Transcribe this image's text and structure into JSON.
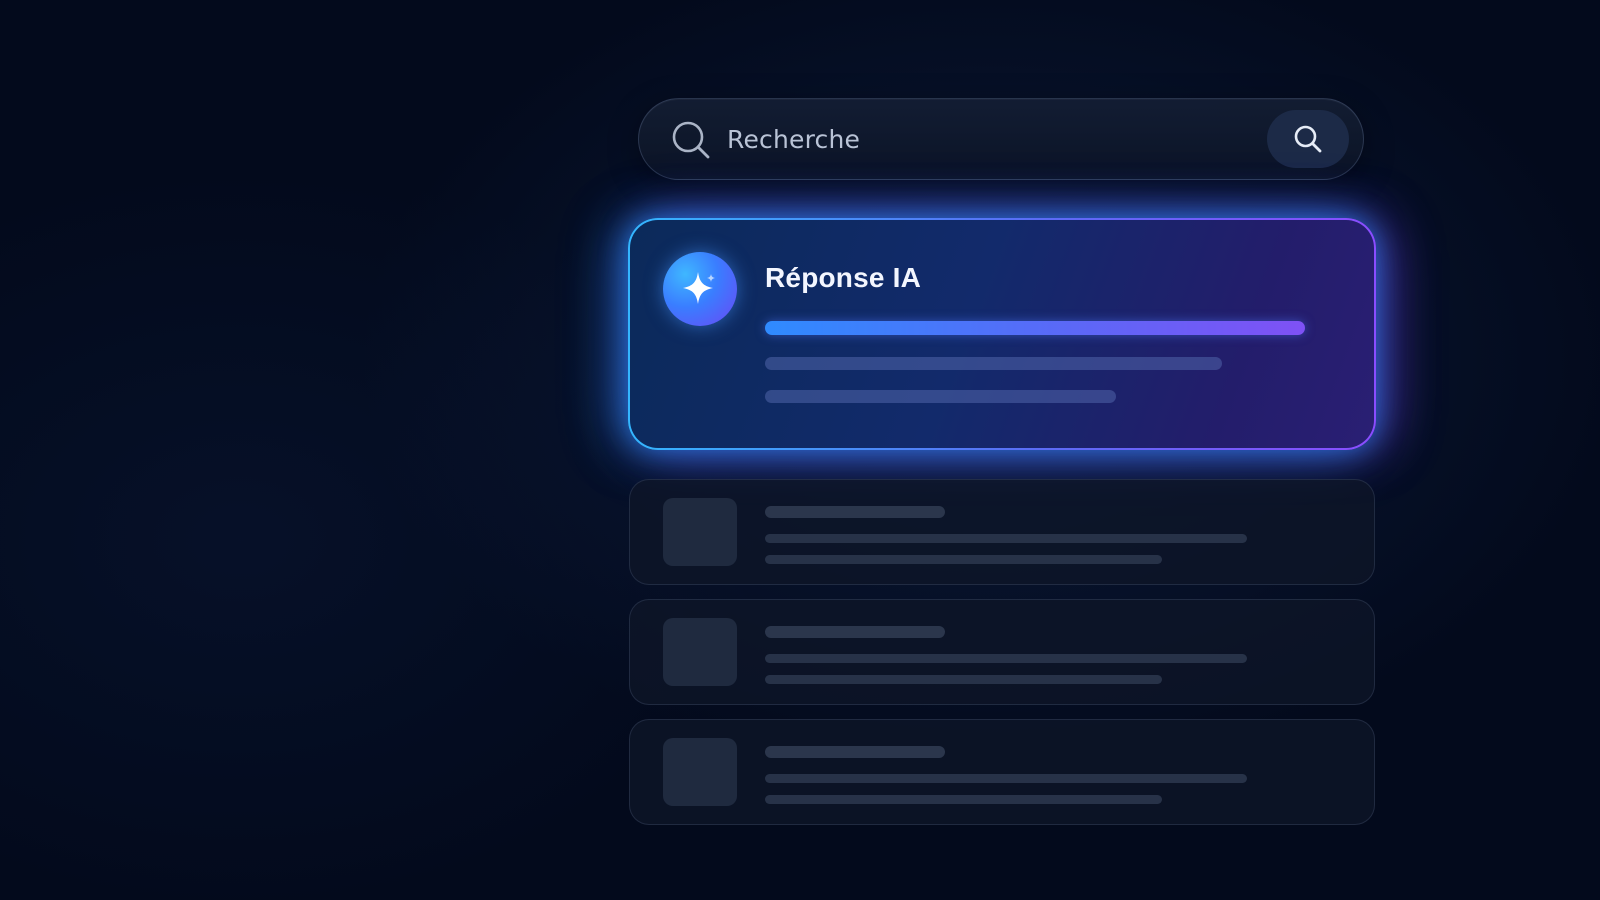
{
  "search": {
    "placeholder": "Recherche",
    "leading_icon": "search-icon",
    "button_icon": "search-icon"
  },
  "ai_card": {
    "title": "Réponse IA",
    "icon": "sparkle-icon",
    "colors": {
      "accent_start": "#34b6ff",
      "accent_end": "#8a4dff"
    }
  },
  "results": [
    {
      "type": "skeleton"
    },
    {
      "type": "skeleton"
    },
    {
      "type": "skeleton"
    }
  ],
  "colors": {
    "background": "#030a1c"
  }
}
